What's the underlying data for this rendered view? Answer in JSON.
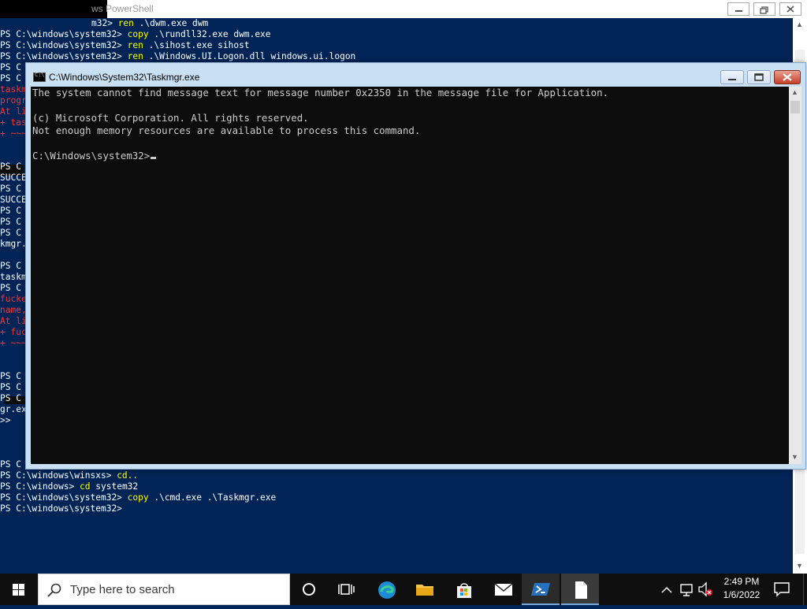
{
  "powershell": {
    "title": "ws PowerShell",
    "lines": [
      {
        "prompt": "m32> ",
        "kw": "ren",
        "arg": " .\\dwm.exe dwm"
      },
      {
        "prompt": "PS C:\\windows\\system32> ",
        "kw": "copy",
        "arg": " .\\rundll32.exe dwm.exe"
      },
      {
        "prompt": "PS C:\\windows\\system32> ",
        "kw": "ren",
        "arg": " .\\sihost.exe sihost"
      },
      {
        "prompt": "PS C:\\windows\\system32> ",
        "kw": "ren",
        "arg": " .\\Windows.UI.Logon.dll windows.ui.logon"
      }
    ],
    "left_fragments": [
      {
        "text": "PS C",
        "cls": "normal"
      },
      {
        "text": "PS C",
        "cls": "normal"
      },
      {
        "text": "taskm",
        "cls": "err"
      },
      {
        "text": "progr",
        "cls": "err"
      },
      {
        "text": "At li",
        "cls": "err"
      },
      {
        "text": "+ tas",
        "cls": "err"
      },
      {
        "text": "+ ~~~",
        "cls": "err"
      },
      {
        "text": "",
        "cls": "normal"
      },
      {
        "text": "",
        "cls": "normal"
      },
      {
        "text": "PS C",
        "cls": "normal"
      },
      {
        "text": "SUCCE",
        "cls": "normal"
      },
      {
        "text": "PS C",
        "cls": "normal"
      },
      {
        "text": "SUCCE",
        "cls": "normal"
      },
      {
        "text": "PS C",
        "cls": "normal"
      },
      {
        "text": "PS C",
        "cls": "normal"
      },
      {
        "text": "PS C",
        "cls": "normal"
      },
      {
        "text": "kmgr.",
        "cls": "normal"
      },
      {
        "text": "",
        "cls": "normal"
      },
      {
        "text": "PS C",
        "cls": "normal"
      },
      {
        "text": "taskm",
        "cls": "normal"
      },
      {
        "text": "PS C",
        "cls": "normal"
      },
      {
        "text": "fucke",
        "cls": "err"
      },
      {
        "text": "name,",
        "cls": "err"
      },
      {
        "text": "At li",
        "cls": "err"
      },
      {
        "text": "+ fuc",
        "cls": "err"
      },
      {
        "text": "+ ~~~",
        "cls": "err"
      },
      {
        "text": "",
        "cls": "normal"
      },
      {
        "text": "",
        "cls": "normal"
      },
      {
        "text": "PS C",
        "cls": "normal"
      },
      {
        "text": "PS C",
        "cls": "normal"
      },
      {
        "text": "PS C",
        "cls": "normal"
      },
      {
        "text": "gr.ex",
        "cls": "normal"
      },
      {
        "text": ">>",
        "cls": "normal"
      }
    ],
    "bottom_lines": [
      {
        "prompt": "PS C",
        "kw": "",
        "arg": ""
      },
      {
        "prompt": "PS C:\\windows\\winsxs> ",
        "kw": "cd..",
        "arg": ""
      },
      {
        "prompt": "PS C:\\windows> ",
        "kw": "cd",
        "arg": " system32"
      },
      {
        "prompt": "PS C:\\windows\\system32> ",
        "kw": "copy",
        "arg": " .\\cmd.exe .\\Taskmgr.exe"
      },
      {
        "prompt": "PS C:\\windows\\system32> ",
        "kw": "",
        "arg": ""
      }
    ]
  },
  "cmd_window": {
    "title": "C:\\Windows\\System32\\Taskmgr.exe",
    "icon_label": "C:\\",
    "lines": [
      "The system cannot find message text for message number 0x2350 in the message file for Application.",
      "",
      "(c) Microsoft Corporation. All rights reserved.",
      "Not enough memory resources are available to process this command.",
      "",
      "C:\\Windows\\system32>"
    ]
  },
  "taskbar": {
    "search_placeholder": "Type here to search",
    "time": "2:49 PM",
    "date": "1/6/2022"
  },
  "colors": {
    "ps_background": "#012456",
    "ps_keyword": "#ffff00",
    "ps_error": "#ff3232",
    "cmd_background": "#0c0c0c",
    "cmd_text": "#cccccc",
    "taskbar": "#0f0f0f"
  }
}
